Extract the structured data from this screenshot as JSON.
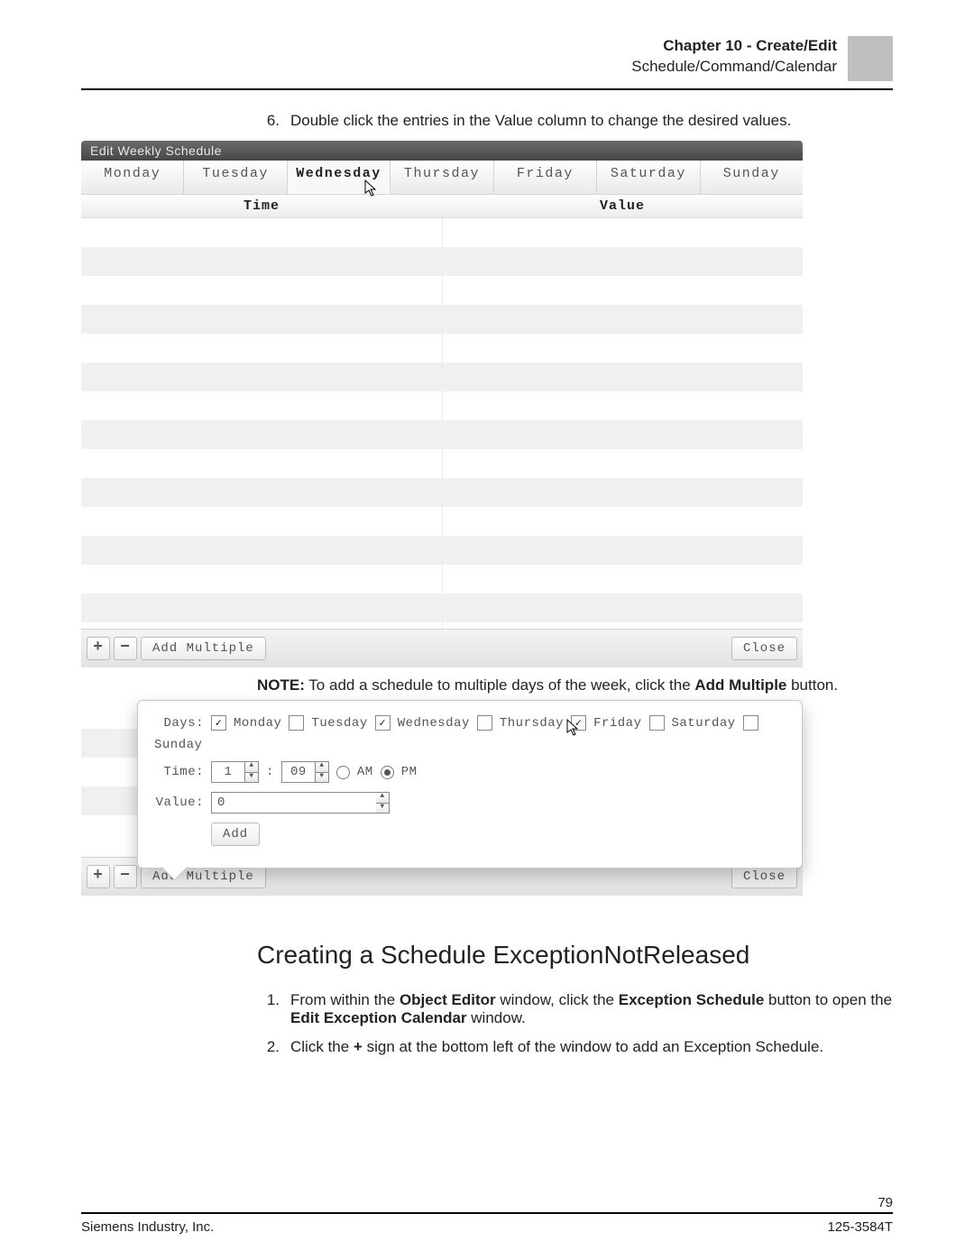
{
  "header": {
    "line1": "Chapter 10 - Create/Edit",
    "line2": "Schedule/Command/Calendar"
  },
  "step6": {
    "num": "6.",
    "text": "Double click the entries in the Value column to change the desired values."
  },
  "win1": {
    "title": "Edit Weekly Schedule",
    "tabs": [
      "Monday",
      "Tuesday",
      "Wednesday",
      "Thursday",
      "Friday",
      "Saturday",
      "Sunday"
    ],
    "active_tab": "Wednesday",
    "cols": {
      "time": "Time",
      "value": "Value"
    },
    "toolbar": {
      "plus": "+",
      "minus": "−",
      "add_multiple": "Add Multiple",
      "close": "Close"
    }
  },
  "note": {
    "label": "NOTE:",
    "text": " To add a schedule to multiple days of the week, click the ",
    "bold": "Add Multiple",
    "tail": " button."
  },
  "popup": {
    "days_label": "Days:",
    "time_label": "Time:",
    "value_label": "Value:",
    "days": [
      {
        "label": "Monday",
        "checked": true
      },
      {
        "label": "Tuesday",
        "checked": false
      },
      {
        "label": "Wednesday",
        "checked": true
      },
      {
        "label": "Thursday",
        "checked": false
      },
      {
        "label": "Friday",
        "checked": true
      },
      {
        "label": "Saturday",
        "checked": false
      },
      {
        "label": "Sunday",
        "checked": false
      }
    ],
    "hour": "1",
    "minute": "09",
    "am": "AM",
    "pm": "PM",
    "ampm_selected": "PM",
    "value": "0",
    "add": "Add"
  },
  "toolbar2": {
    "plus": "+",
    "minus": "−",
    "add_multiple": "Add Multiple",
    "close": "Close"
  },
  "section2": {
    "title": "Creating a Schedule ExceptionNotReleased",
    "items": [
      {
        "num": "1.",
        "pre": "From within the ",
        "b1": "Object Editor",
        "mid1": " window, click the ",
        "b2": "Exception Schedule",
        "mid2": " button to open the ",
        "b3": "Edit Exception Calendar",
        "post": " window."
      },
      {
        "num": "2.",
        "pre": "Click the ",
        "b1": "+",
        "post": " sign at the bottom left of the window to add an Exception Schedule."
      }
    ]
  },
  "footer": {
    "page": "79",
    "left": "Siemens Industry, Inc.",
    "right": "125-3584T"
  }
}
